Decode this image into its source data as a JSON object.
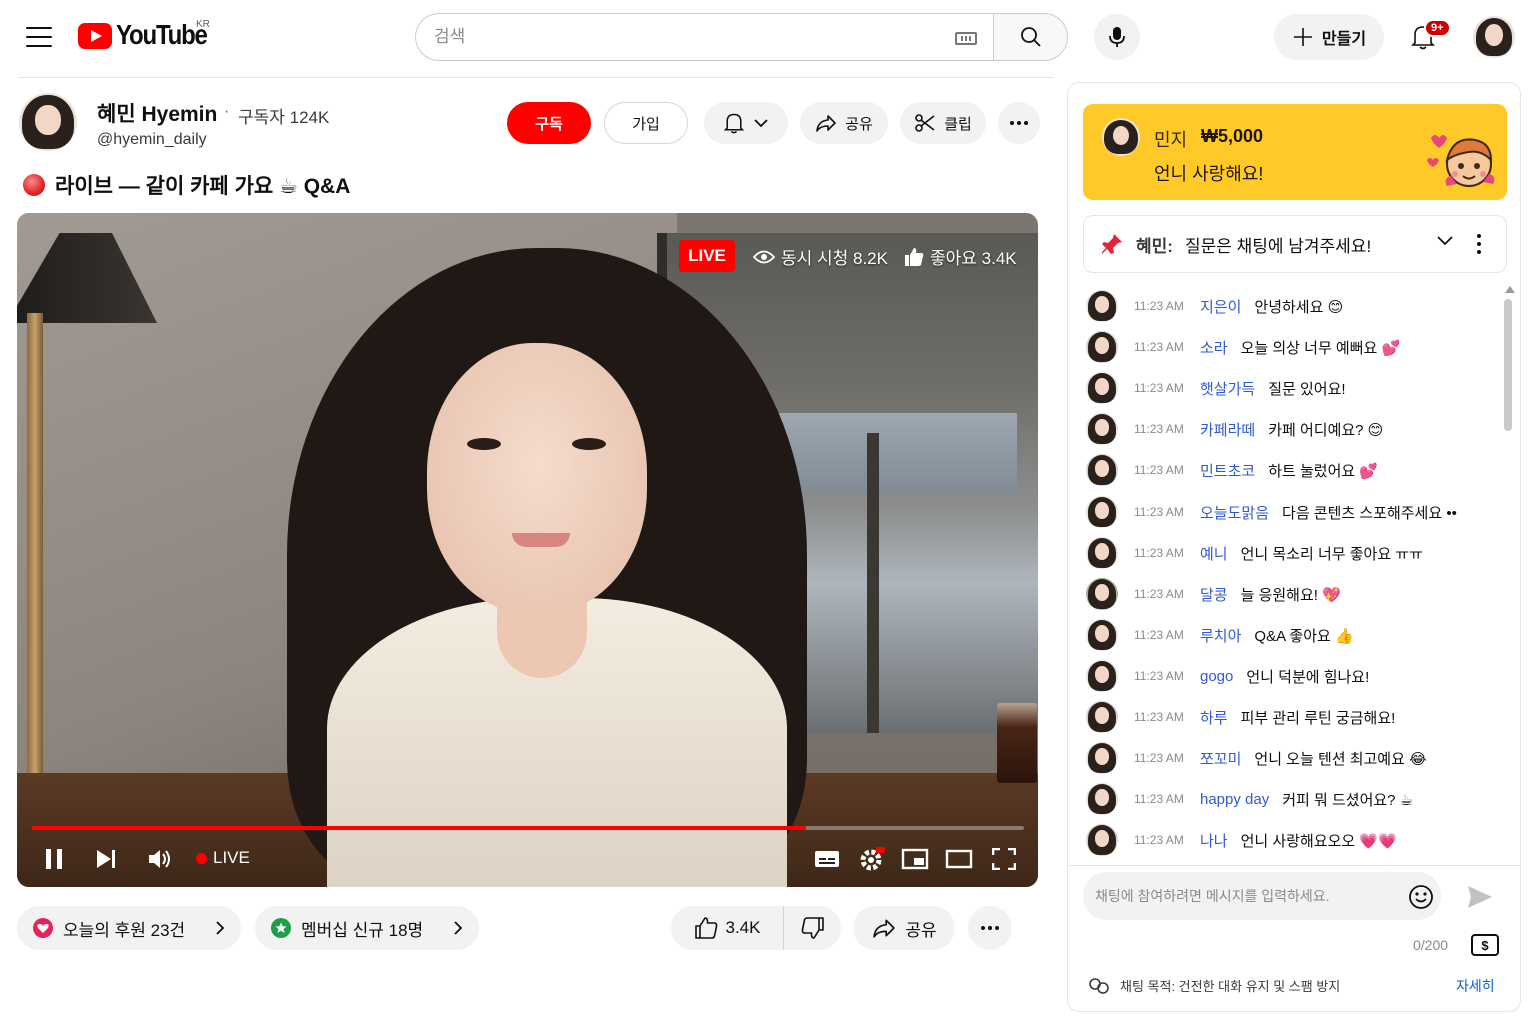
{
  "header": {
    "menu_icon": "hamburger-menu-icon",
    "logo_text": "YouTube",
    "logo_region": "KR",
    "search_placeholder": "검색",
    "create_label": "만들기",
    "notification_count": "9+"
  },
  "channel": {
    "name": "혜민 Hyemin",
    "separator": "·",
    "subscribers": "구독자 124K",
    "handle": "@hyemin_daily",
    "subscribe_label": "구독",
    "join_label": "가입",
    "share_label": "공유",
    "clip_label": "클립"
  },
  "video": {
    "title": "라이브 — 같이 카페 가요 ☕ Q&A",
    "live_badge": "LIVE",
    "concurrent_viewers": "동시 시청 8.2K",
    "likes_overlay": "좋아요 3.4K",
    "player_live_label": "LIVE",
    "progress_fraction": 0.78,
    "accent_color": "#ff0000"
  },
  "actions": {
    "support_label": "오늘의 후원 23건",
    "membership_label": "멤버십 신규 18명",
    "like_count": "3.4K",
    "share_label": "공유"
  },
  "chat": {
    "superchat": {
      "name": "민지",
      "amount": "₩5,000",
      "message": "언니 사랑해요!",
      "color": "#ffca28"
    },
    "pinned": {
      "author": "혜민:",
      "text": "질문은 채팅에 남겨주세요!"
    },
    "messages": [
      {
        "time": "11:23 AM",
        "user": "지은이",
        "text": "안녕하세요 😊"
      },
      {
        "time": "11:23 AM",
        "user": "소라",
        "text": "오늘 의상 너무 예뻐요 💕"
      },
      {
        "time": "11:23 AM",
        "user": "햇살가득",
        "text": "질문 있어요!"
      },
      {
        "time": "11:23 AM",
        "user": "카페라떼",
        "text": "카페 어디예요? 😊"
      },
      {
        "time": "11:23 AM",
        "user": "민트초코",
        "text": "하트 눌렀어요 💕"
      },
      {
        "time": "11:23 AM",
        "user": "오늘도맑음",
        "text": "다음 콘텐츠 스포해주세요 ••"
      },
      {
        "time": "11:23 AM",
        "user": "예니",
        "text": "언니 목소리 너무 좋아요 ㅠㅠ"
      },
      {
        "time": "11:23 AM",
        "user": "달콩",
        "text": "늘 응원해요! 💖"
      },
      {
        "time": "11:23 AM",
        "user": "루치아",
        "text": "Q&A 좋아요 👍"
      },
      {
        "time": "11:23 AM",
        "user": "gogo",
        "text": "언니 덕분에 힘나요!"
      },
      {
        "time": "11:23 AM",
        "user": "하루",
        "text": "피부 관리 루틴 궁금해요!"
      },
      {
        "time": "11:23 AM",
        "user": "쪼꼬미",
        "text": "언니 오늘 텐션 최고예요 😂"
      },
      {
        "time": "11:23 AM",
        "user": "happy day",
        "text": "커피 뭐 드셨어요? ☕"
      },
      {
        "time": "11:23 AM",
        "user": "나나",
        "text": "언니 사랑해요오오 💗💗"
      }
    ],
    "input_placeholder": "채팅에 참여하려면 메시지를 입력하세요.",
    "char_count": "0/200",
    "dollar_label": "$",
    "footer_text": "채팅 목적: 건전한 대화 유지 및 스팸 방지",
    "footer_link": "자세히"
  }
}
